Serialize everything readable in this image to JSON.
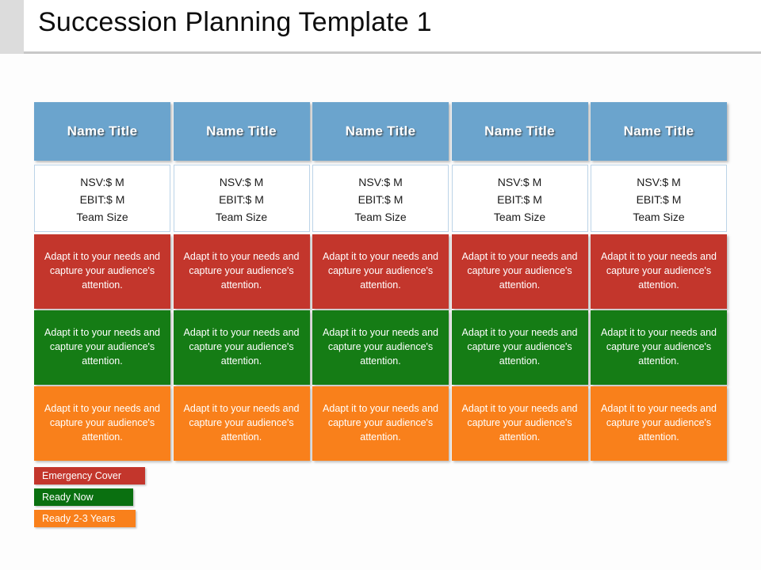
{
  "slide": {
    "title": "Succession Planning Template 1"
  },
  "colors": {
    "header_blue": "#6ba4cd",
    "emergency_red": "#c3362c",
    "ready_now_green": "#157c15",
    "ready_2_3_orange": "#f9801b",
    "legend_green": "#0a7010",
    "stats_border": "#bcd4e8",
    "title_text": "#0d0d0d",
    "gutter_gray": "#dcdcdc"
  },
  "columns": [
    {
      "header": "Name Title",
      "stats": [
        "NSV:$ M",
        "EBIT:$  M",
        "Team Size"
      ],
      "cards": [
        {
          "tier": "emergency-cover",
          "text": "Adapt it to your needs and capture your audience's attention."
        },
        {
          "tier": "ready-now",
          "text": "Adapt it to your needs and capture your audience's attention."
        },
        {
          "tier": "ready-2-3-years",
          "text": "Adapt it to your needs and capture your audience's attention."
        }
      ]
    },
    {
      "header": "Name Title",
      "stats": [
        "NSV:$ M",
        "EBIT:$  M",
        "Team Size"
      ],
      "cards": [
        {
          "tier": "emergency-cover",
          "text": "Adapt it to your needs and capture your audience's attention."
        },
        {
          "tier": "ready-now",
          "text": "Adapt it to your needs and capture your audience's attention."
        },
        {
          "tier": "ready-2-3-years",
          "text": "Adapt it to your needs and capture your audience's attention."
        }
      ]
    },
    {
      "header": "Name Title",
      "stats": [
        "NSV:$ M",
        "EBIT:$  M",
        "Team Size"
      ],
      "cards": [
        {
          "tier": "emergency-cover",
          "text": "Adapt it to your needs and capture your audience's attention."
        },
        {
          "tier": "ready-now",
          "text": "Adapt it to your needs and capture your audience's attention."
        },
        {
          "tier": "ready-2-3-years",
          "text": "Adapt it to your needs and capture your audience's attention."
        }
      ]
    },
    {
      "header": "Name Title",
      "stats": [
        "NSV:$ M",
        "EBIT:$  M",
        "Team Size"
      ],
      "cards": [
        {
          "tier": "emergency-cover",
          "text": "Adapt it to your needs and capture your audience's attention."
        },
        {
          "tier": "ready-now",
          "text": "Adapt it to your needs and capture your audience's attention."
        },
        {
          "tier": "ready-2-3-years",
          "text": "Adapt it to your needs and capture your audience's attention."
        }
      ]
    },
    {
      "header": "Name Title",
      "stats": [
        "NSV:$ M",
        "EBIT:$  M",
        "Team Size"
      ],
      "cards": [
        {
          "tier": "emergency-cover",
          "text": "Adapt it to your needs and capture your audience's attention."
        },
        {
          "tier": "ready-now",
          "text": "Adapt it to your needs and capture your audience's attention."
        },
        {
          "tier": "ready-2-3-years",
          "text": "Adapt it to your needs and capture your audience's attention."
        }
      ]
    }
  ],
  "legend": [
    {
      "label": "Emergency Cover",
      "tier": "emergency-cover"
    },
    {
      "label": "Ready Now",
      "tier": "ready-now"
    },
    {
      "label": "Ready 2-3 Years",
      "tier": "ready-2-3-years"
    }
  ]
}
